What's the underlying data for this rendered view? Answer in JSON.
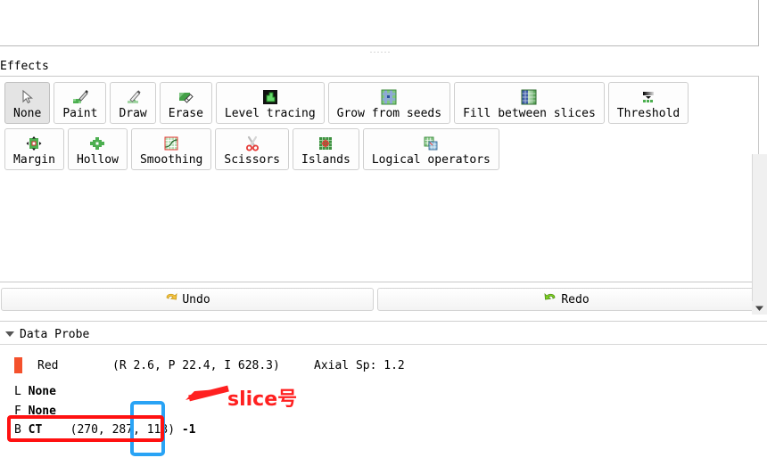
{
  "window": {
    "top_panel_empty": true
  },
  "effects": {
    "section_label": "Effects",
    "buttons_row1": [
      {
        "label": "None",
        "icon": "cursor-arrow-icon",
        "selected": true
      },
      {
        "label": "Paint",
        "icon": "paintbrush-icon",
        "selected": false
      },
      {
        "label": "Draw",
        "icon": "pencil-draw-icon",
        "selected": false
      },
      {
        "label": "Erase",
        "icon": "eraser-icon",
        "selected": false
      },
      {
        "label": "Level tracing",
        "icon": "level-tracing-icon",
        "selected": false
      },
      {
        "label": "Grow from seeds",
        "icon": "grow-from-seeds-icon",
        "selected": false
      },
      {
        "label": "Fill between slices",
        "icon": "fill-between-slices-icon",
        "selected": false
      },
      {
        "label": "Threshold",
        "icon": "threshold-icon",
        "selected": false
      }
    ],
    "buttons_row2": [
      {
        "label": "Margin",
        "icon": "margin-icon",
        "selected": false
      },
      {
        "label": "Hollow",
        "icon": "hollow-icon",
        "selected": false
      },
      {
        "label": "Smoothing",
        "icon": "smoothing-icon",
        "selected": false
      },
      {
        "label": "Scissors",
        "icon": "scissors-icon",
        "selected": false
      },
      {
        "label": "Islands",
        "icon": "islands-icon",
        "selected": false
      },
      {
        "label": "Logical operators",
        "icon": "logical-operators-icon",
        "selected": false
      }
    ]
  },
  "history": {
    "undo_label": "Undo",
    "redo_label": "Redo",
    "undo_icon": "undo-arrow-icon",
    "redo_icon": "redo-arrow-icon"
  },
  "data_probe": {
    "title": "Data Probe",
    "collapse_icon": "chevron-down-icon",
    "color_swatch": "#f4512c",
    "view_name": "Red",
    "coordinates": "(R 2.6, P 22.4, I 628.3)",
    "spacing": "Axial Sp: 1.2",
    "rows": [
      {
        "corner": "L",
        "layer": "None",
        "values": "",
        "intensity": ""
      },
      {
        "corner": "F",
        "layer": "None",
        "values": "",
        "intensity": ""
      },
      {
        "corner": "B",
        "layer": "CT",
        "values": "(270, 287, 113)",
        "intensity": "-1"
      }
    ]
  },
  "annotations": {
    "callout_text": "slice号",
    "callout_color": "#ff2020",
    "red_box_color": "#ff1111",
    "blue_box_color": "#29a3f5"
  },
  "scrollbar": {
    "down_arrow_icon": "scroll-down-arrow-icon"
  }
}
